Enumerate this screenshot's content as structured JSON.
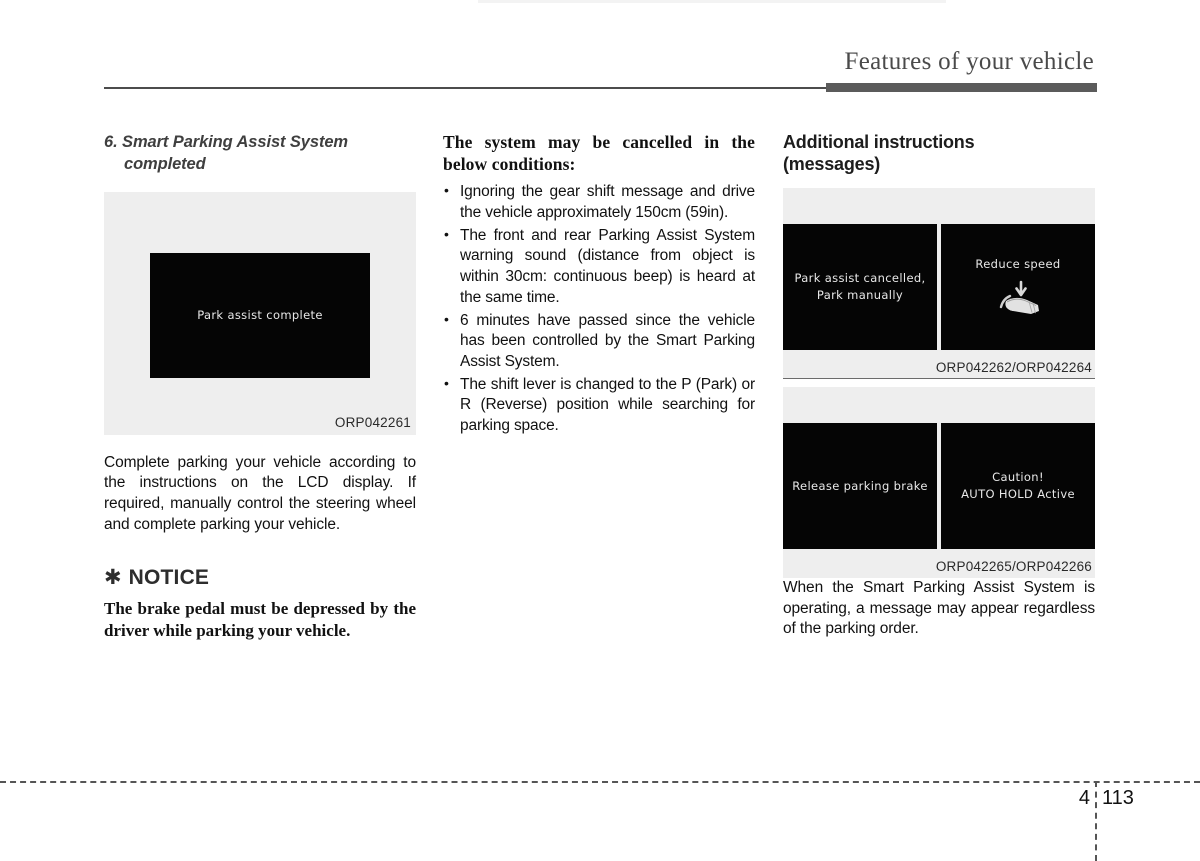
{
  "header": {
    "title": "Features of your vehicle"
  },
  "footer": {
    "chapter": "4",
    "page": "113"
  },
  "left_column": {
    "heading_line1": "6. Smart Parking Assist System",
    "heading_line2": "completed",
    "figure": {
      "lcd_text": "Park assist complete",
      "caption": "ORP042261"
    },
    "paragraph": "Complete parking your vehicle according to the instructions on the LCD display. If required, manually control the steering wheel and complete parking your vehicle.",
    "notice": {
      "star_glyph": "✱",
      "title": "NOTICE",
      "body": "The brake pedal must be depressed by the driver while parking your vehicle."
    }
  },
  "middle_column": {
    "heading": "The system may be cancelled in the below conditions:",
    "bullets": [
      "Ignoring the gear shift message and drive the vehicle approximately 150cm (59in).",
      "The front and rear Parking Assist System warning sound (distance from object is within 30cm: continuous beep) is heard at the same time.",
      "6 minutes have passed since the vehicle has been controlled by the Smart Parking Assist System.",
      "The shift lever is changed to the P (Park) or R (Reverse) position while searching for parking space."
    ]
  },
  "right_column": {
    "heading_line1": "Additional instructions",
    "heading_line2": "(messages)",
    "figure_group_1": {
      "panel_left_line1": "Park assist cancelled,",
      "panel_left_line2": "Park manually",
      "panel_right_line1": "Reduce speed",
      "panel_right_icon": "foot-brake-pedal-icon",
      "caption": "ORP042262/ORP042264"
    },
    "figure_group_2": {
      "panel_left_line1": "Release parking brake",
      "panel_right_line1": "Caution!",
      "panel_right_line2": "AUTO HOLD Active",
      "caption": "ORP042265/ORP042266"
    },
    "paragraph": "When the Smart Parking Assist System is operating, a message may appear regardless of the parking order."
  },
  "colors": {
    "lcd_background": "#050505",
    "lcd_text": "#e8e8e8",
    "figure_background": "#eeeeee",
    "header_bar": "#5b5b5b",
    "header_text": "#4a4a4a"
  }
}
